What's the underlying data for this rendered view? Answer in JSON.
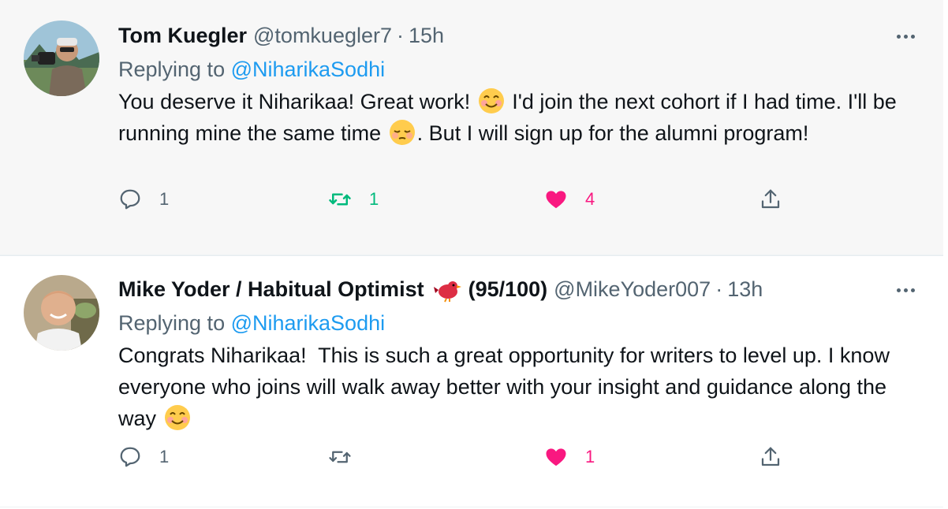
{
  "tweets": [
    {
      "author_name": "Tom Kuegler",
      "handle": "@tomkuegler7",
      "separator": "·",
      "time": "15h",
      "replying_prefix": "Replying to",
      "replying_to": "@NiharikaSodhi",
      "text_parts": [
        "You deserve it Niharikaa! Great work! ",
        " I'd join the next cohort if I had time. I'll be running mine the same time ",
        ". But I will sign up for the alumni program!"
      ],
      "emojis": [
        "smiling-face-emoji",
        "pensive-face-emoji"
      ],
      "reply_count": "1",
      "retweet_count": "1",
      "like_count": "4",
      "retweeted": true,
      "liked": true
    },
    {
      "author_name": "Mike Yoder / Habitual Optimist",
      "badge_icon": "red-bird-emoji",
      "score": "(95/100)",
      "handle": "@MikeYoder007",
      "separator": "·",
      "time": "13h",
      "replying_prefix": "Replying to",
      "replying_to": "@NiharikaSodhi",
      "text_parts": [
        "Congrats Niharikaa!  This is such a great opportunity for writers to level up. I know everyone who joins will walk away better with your insight and guidance along the way "
      ],
      "emojis": [
        "smiling-face-emoji"
      ],
      "reply_count": "1",
      "retweet_count": "",
      "like_count": "1",
      "retweeted": false,
      "liked": true
    }
  ],
  "colors": {
    "accent_blue": "#1d9bf0",
    "retweet_green": "#00ba7c",
    "like_pink": "#f91880",
    "muted_gray": "#536471"
  }
}
